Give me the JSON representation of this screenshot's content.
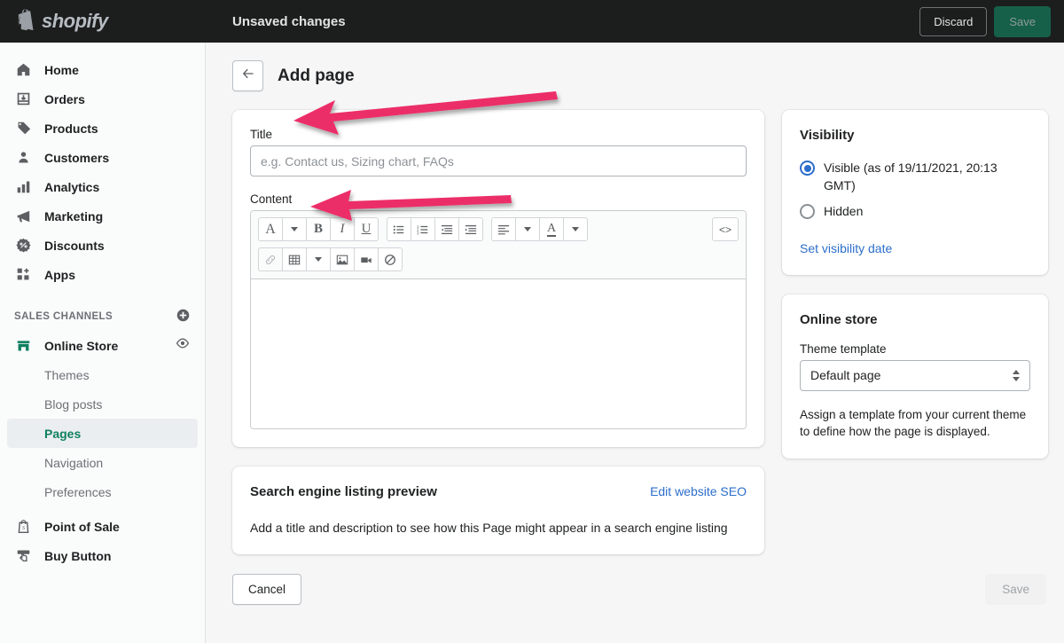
{
  "topbar": {
    "brand": "shopify",
    "status": "Unsaved changes",
    "discard_label": "Discard",
    "save_label": "Save"
  },
  "sidebar": {
    "items": [
      {
        "label": "Home",
        "icon": "home-icon"
      },
      {
        "label": "Orders",
        "icon": "orders-icon"
      },
      {
        "label": "Products",
        "icon": "tag-icon"
      },
      {
        "label": "Customers",
        "icon": "person-icon"
      },
      {
        "label": "Analytics",
        "icon": "bar-chart-icon"
      },
      {
        "label": "Marketing",
        "icon": "megaphone-icon"
      },
      {
        "label": "Discounts",
        "icon": "discount-badge-icon"
      },
      {
        "label": "Apps",
        "icon": "apps-grid-icon"
      }
    ],
    "section_title": "SALES CHANNELS",
    "add_channel_icon": "plus-circle-icon",
    "online_store": {
      "label": "Online Store",
      "icon": "storefront-icon",
      "view_icon": "eye-icon"
    },
    "sub_items": [
      {
        "label": "Themes",
        "active": false
      },
      {
        "label": "Blog posts",
        "active": false
      },
      {
        "label": "Pages",
        "active": true
      },
      {
        "label": "Navigation",
        "active": false
      },
      {
        "label": "Preferences",
        "active": false
      }
    ],
    "channels": [
      {
        "label": "Point of Sale",
        "icon": "pos-bag-icon"
      },
      {
        "label": "Buy Button",
        "icon": "buy-button-icon"
      }
    ]
  },
  "page": {
    "back_icon": "arrow-left-icon",
    "title": "Add page"
  },
  "title_field": {
    "label": "Title",
    "value": "",
    "placeholder": "e.g. Contact us, Sizing chart, FAQs"
  },
  "content_field": {
    "label": "Content",
    "value": "",
    "toolbar_row1": [
      {
        "name": "format-style-icon",
        "glyph": "A",
        "caret": true
      },
      {
        "name": "bold-icon",
        "glyph": "B",
        "caret": false
      },
      {
        "name": "italic-icon",
        "glyph": "I",
        "caret": false
      },
      {
        "name": "underline-icon",
        "glyph": "U",
        "caret": false
      },
      {
        "name": "bulleted-list-icon",
        "glyph": "list-ul",
        "caret": false
      },
      {
        "name": "numbered-list-icon",
        "glyph": "list-ol",
        "caret": false
      },
      {
        "name": "outdent-icon",
        "glyph": "outdent",
        "caret": false
      },
      {
        "name": "indent-icon",
        "glyph": "indent",
        "caret": false
      },
      {
        "name": "align-icon",
        "glyph": "align",
        "caret": true
      },
      {
        "name": "text-color-icon",
        "glyph": "A-underline",
        "caret": true
      }
    ],
    "code_view_label": "<>",
    "toolbar_row2": [
      {
        "name": "link-icon",
        "glyph": "link",
        "disabled": true
      },
      {
        "name": "table-icon",
        "glyph": "table",
        "caret": true
      },
      {
        "name": "insert-image-icon",
        "glyph": "image",
        "caret": false
      },
      {
        "name": "insert-video-icon",
        "glyph": "video",
        "caret": false
      },
      {
        "name": "clear-formatting-icon",
        "glyph": "no-entry",
        "caret": false
      }
    ]
  },
  "seo": {
    "title": "Search engine listing preview",
    "edit_link": "Edit website SEO",
    "body": "Add a title and description to see how this Page might appear in a search engine listing"
  },
  "visibility": {
    "title": "Visibility",
    "options": [
      {
        "label": "Visible (as of 19/11/2021, 20:13 GMT)",
        "selected": true
      },
      {
        "label": "Hidden",
        "selected": false
      }
    ],
    "set_date_link": "Set visibility date"
  },
  "online_store_card": {
    "title": "Online store",
    "template_label": "Theme template",
    "template_value": "Default page",
    "help_text": "Assign a template from your current theme to define how the page is displayed."
  },
  "footer": {
    "cancel_label": "Cancel",
    "save_label": "Save"
  },
  "annotations": {
    "arrow_color": "#ec2f67",
    "arrows": [
      {
        "name": "arrow-pointing-to-title-field"
      },
      {
        "name": "arrow-pointing-to-content-field"
      }
    ]
  },
  "colors": {
    "accent_green": "#108060",
    "link_blue": "#2c6ecb",
    "topbar_bg": "#1c1d1d",
    "save_green": "#16604a"
  }
}
